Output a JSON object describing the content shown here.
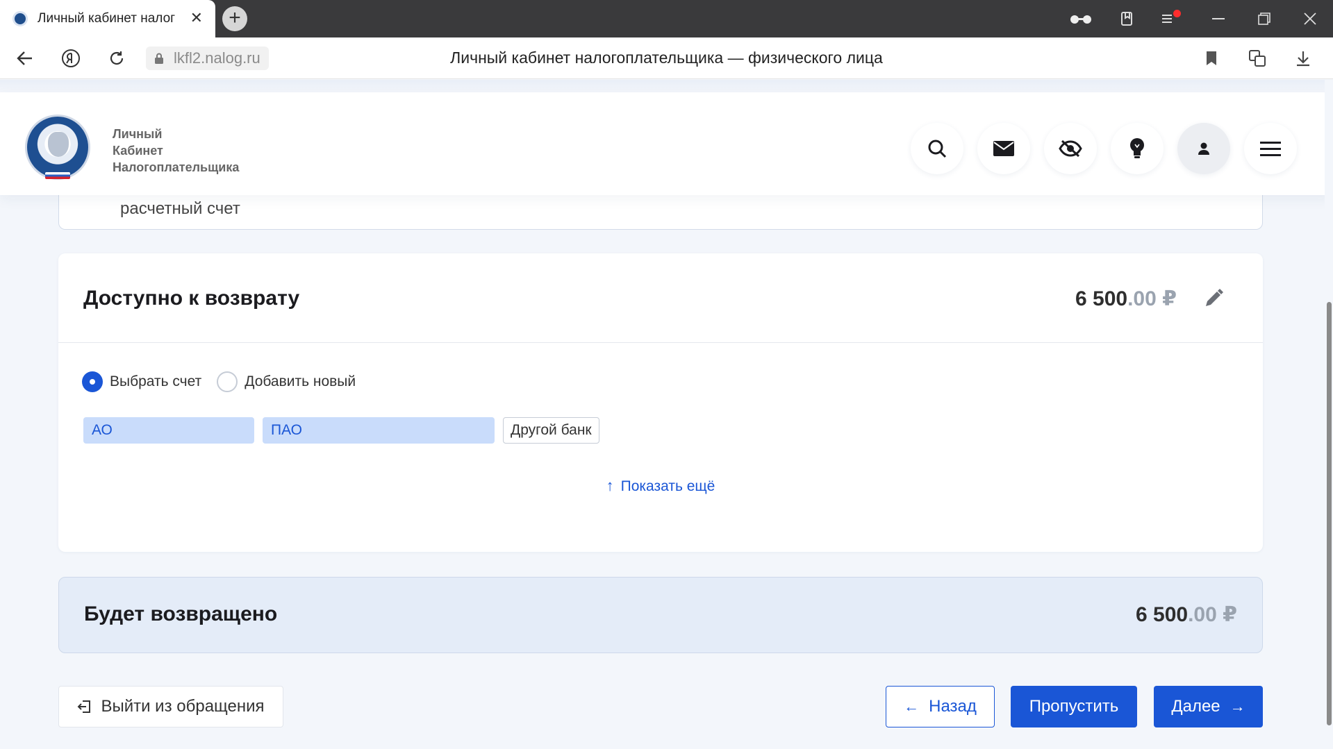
{
  "browser": {
    "tab_title": "Личный кабинет налог",
    "tab_close": "✕",
    "new_tab": "+",
    "url": "lkfl2.nalog.ru",
    "page_title": "Личный кабинет налогоплательщика — физического лица"
  },
  "header": {
    "brand_line1": "Личный",
    "brand_line2": "Кабинет",
    "brand_line3": "Налогоплательщика",
    "icons": [
      "search-icon",
      "mail-icon",
      "eye-off-icon",
      "lightbulb-icon",
      "user-icon",
      "menu-icon"
    ]
  },
  "prev_card": {
    "text": "расчетный счет"
  },
  "refund_card": {
    "title": "Доступно к возврату",
    "amount_int": "6 500",
    "amount_dec": ".00 ₽",
    "radio_select": "Выбрать счет",
    "radio_add": "Добавить новый",
    "chips": [
      "АО",
      "ПАО",
      "Другой банк"
    ],
    "show_more": "Показать ещё"
  },
  "total_card": {
    "title": "Будет возвращено",
    "amount_int": "6 500",
    "amount_dec": ".00 ₽"
  },
  "footer": {
    "exit_label": "Выйти из обращения",
    "back_label": "Назад",
    "skip_label": "Пропустить",
    "next_label": "Далее"
  },
  "colors": {
    "accent": "#1a56d6",
    "chip_bg": "#c9dcfb",
    "total_bg": "#e4ecf8"
  }
}
